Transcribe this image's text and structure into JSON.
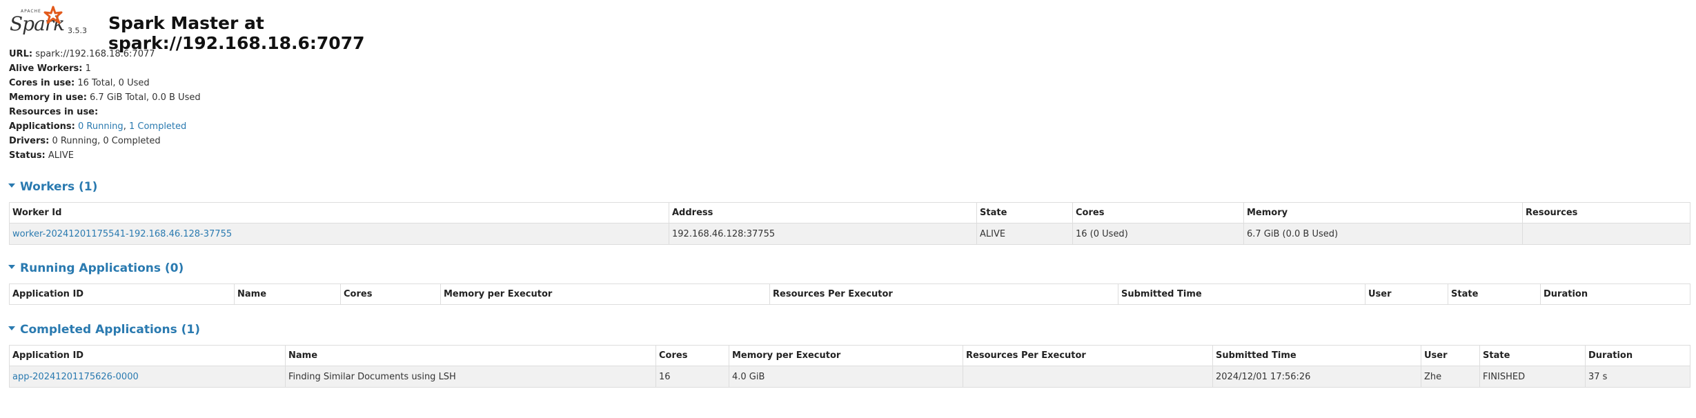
{
  "header": {
    "logo_small_text": "APACHE",
    "logo_text": "Spark",
    "version": "3.5.3",
    "title": "Spark Master at spark://192.168.18.6:7077"
  },
  "summary": {
    "url_label": "URL:",
    "url_value": "spark://192.168.18.6:7077",
    "alive_label": "Alive Workers:",
    "alive_value": "1",
    "cores_label": "Cores in use:",
    "cores_value": "16 Total, 0 Used",
    "memory_label": "Memory in use:",
    "memory_value": "6.7 GiB Total, 0.0 B Used",
    "resources_label": "Resources in use:",
    "apps_label": "Applications:",
    "apps_running": "0 Running",
    "apps_sep": ",",
    "apps_completed": "1 Completed",
    "drivers_label": "Drivers:",
    "drivers_value": "0 Running, 0 Completed",
    "status_label": "Status:",
    "status_value": "ALIVE"
  },
  "workers": {
    "title": "Workers (1)",
    "columns": [
      "Worker Id",
      "Address",
      "State",
      "Cores",
      "Memory",
      "Resources"
    ],
    "rows": [
      {
        "worker_id": "worker-20241201175541-192.168.46.128-37755",
        "address": "192.168.46.128:37755",
        "state": "ALIVE",
        "cores": "16 (0 Used)",
        "memory": "6.7 GiB (0.0 B Used)",
        "resources": ""
      }
    ]
  },
  "running_apps": {
    "title": "Running Applications (0)",
    "columns": [
      "Application ID",
      "Name",
      "Cores",
      "Memory per Executor",
      "Resources Per Executor",
      "Submitted Time",
      "User",
      "State",
      "Duration"
    ]
  },
  "completed_apps": {
    "title": "Completed Applications (1)",
    "columns": [
      "Application ID",
      "Name",
      "Cores",
      "Memory per Executor",
      "Resources Per Executor",
      "Submitted Time",
      "User",
      "State",
      "Duration"
    ],
    "rows": [
      {
        "app_id": "app-20241201175626-0000",
        "name": "Finding Similar Documents using LSH",
        "cores": "16",
        "memory": "4.0 GiB",
        "resources": "",
        "submitted": "2024/12/01 17:56:26",
        "user": "Zhe",
        "state": "FINISHED",
        "duration": "37 s"
      }
    ]
  },
  "colors": {
    "link": "#2a7ab0",
    "logo_star": "#e25a1c",
    "row_bg": "#f1f1f1",
    "border": "#dddddd"
  }
}
